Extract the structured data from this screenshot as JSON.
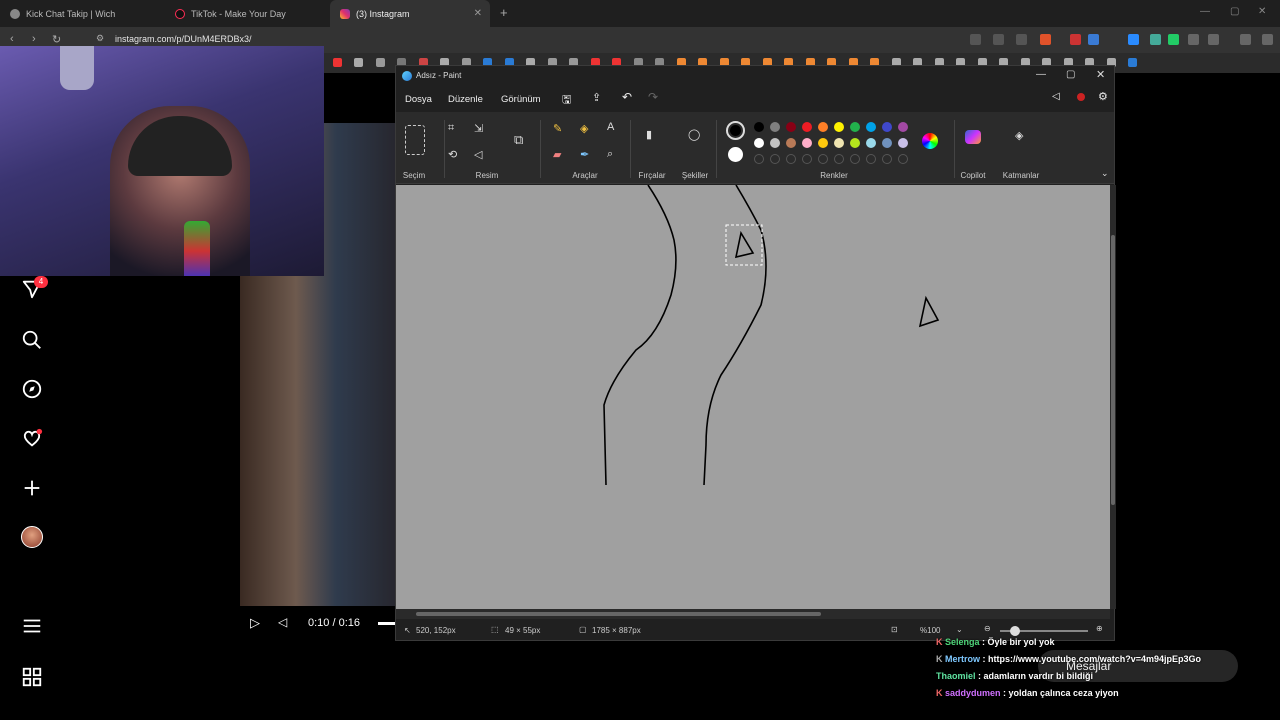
{
  "browser": {
    "tabs": [
      {
        "title": "Kick Chat Takip | Wich",
        "active": false
      },
      {
        "title": "TikTok - Make Your Day",
        "active": false
      },
      {
        "title": "(3) Instagram",
        "active": true
      }
    ],
    "url": "instagram.com/p/DUnM4ERDBx3/"
  },
  "instagram": {
    "notification_count": "4",
    "nav": [
      "messages-icon",
      "search-icon",
      "explore-icon",
      "heart-icon",
      "create-icon",
      "avatar",
      "menu-icon",
      "more-apps-icon"
    ],
    "video_time": "0:10 / 0:16"
  },
  "paint": {
    "title": "Adsız - Paint",
    "menu": {
      "file": "Dosya",
      "edit": "Düzenle",
      "view": "Görünüm"
    },
    "groups": {
      "selection": "Seçim",
      "image": "Resim",
      "tools": "Araçlar",
      "brushes": "Fırçalar",
      "shapes": "Şekiller",
      "colors": "Renkler",
      "copilot": "Copilot",
      "layers": "Katmanlar"
    },
    "palette": [
      "#000000",
      "#7f7f7f",
      "#880015",
      "#ed1c24",
      "#ff7f27",
      "#fff200",
      "#22b14c",
      "#00a2e8",
      "#3f48cc",
      "#a349a4",
      "#ffffff",
      "#c3c3c3",
      "#b97a57",
      "#ffaec9",
      "#ffc90e",
      "#efe4b0",
      "#b5e61d",
      "#99d9ea",
      "#7092be",
      "#c8bfe7"
    ],
    "primary_color": "#000000",
    "secondary_color": "#ffffff",
    "status": {
      "cursor": "520, 152px",
      "selection": "49 × 55px",
      "canvas_size": "1785 × 887px",
      "zoom": "%100"
    }
  },
  "chat": {
    "lines": [
      {
        "user": "Selenga",
        "badge": "K",
        "color": "#4fd67a",
        "text": " : Öyle bir yol yok"
      },
      {
        "user": "Mertrow",
        "badge": "K",
        "color": "#7ec8ff",
        "text": " : https://www.youtube.com/watch?v=4m94jpEp3Go"
      },
      {
        "user": "Thaomiel",
        "badge": "",
        "color": "#5fe3a1",
        "text": " : adamların vardır bi bildiği"
      },
      {
        "user": "saddydumen",
        "badge": "K",
        "color": "#d070ff",
        "text": " : yoldan çalınca ceza yiyon"
      }
    ],
    "messages_label": "Mesajlar"
  }
}
